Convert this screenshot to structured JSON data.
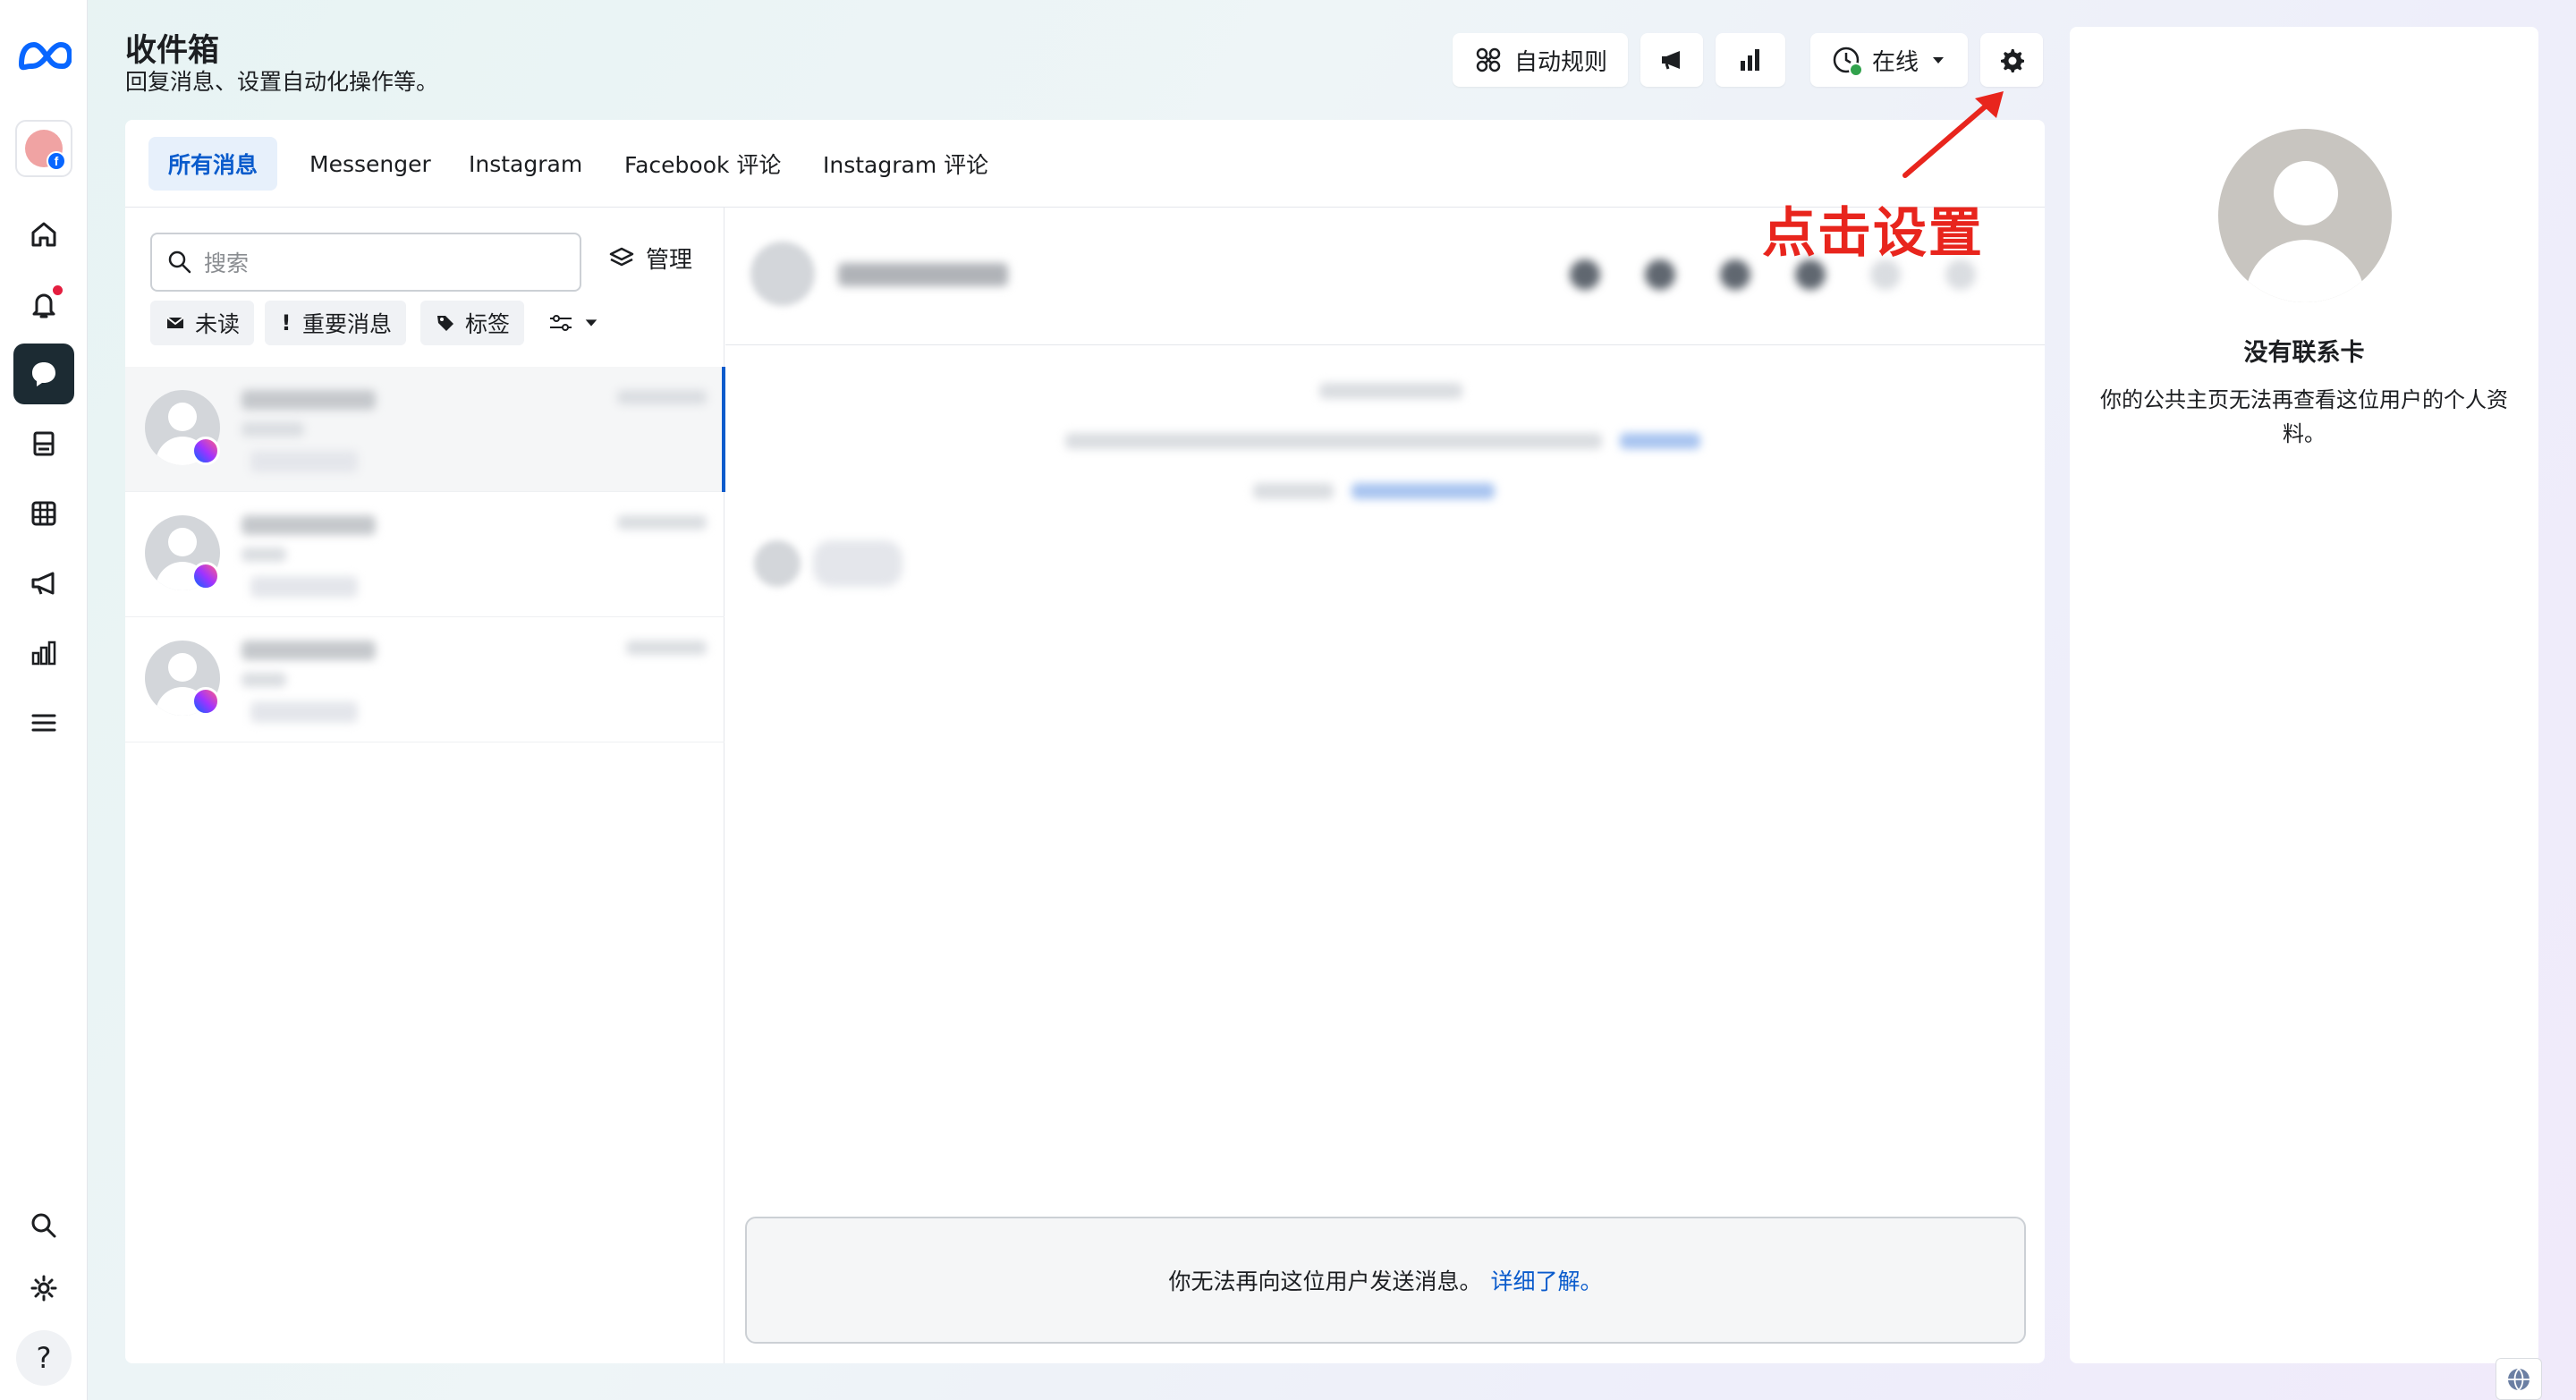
{
  "header": {
    "title": "收件箱",
    "subtitle": "回复消息、设置自动化操作等。",
    "auto_rules_label": "自动规则",
    "status_label": "在线"
  },
  "tabs": [
    {
      "label": "所有消息",
      "active": true
    },
    {
      "label": "Messenger"
    },
    {
      "label": "Instagram"
    },
    {
      "label": "Facebook 评论"
    },
    {
      "label": "Instagram 评论"
    }
  ],
  "list": {
    "search_placeholder": "搜索",
    "manage_label": "管理",
    "filters": [
      {
        "label": "未读",
        "icon": "envelope-icon"
      },
      {
        "label": "重要消息",
        "icon": "exclamation-icon"
      },
      {
        "label": "标签",
        "icon": "tag-icon"
      }
    ]
  },
  "chat": {
    "notice_text": "你无法再向这位用户发送消息。",
    "notice_link": "详细了解。"
  },
  "contact_panel": {
    "title": "没有联系卡",
    "description": "你的公共主页无法再查看这位用户的个人资料。"
  },
  "annotation": {
    "text": "点击设置"
  },
  "colors": {
    "accent": "#0a5bcc",
    "annotation": "#e8251d",
    "active_rail": "#1c2b33",
    "online": "#31a24c"
  }
}
